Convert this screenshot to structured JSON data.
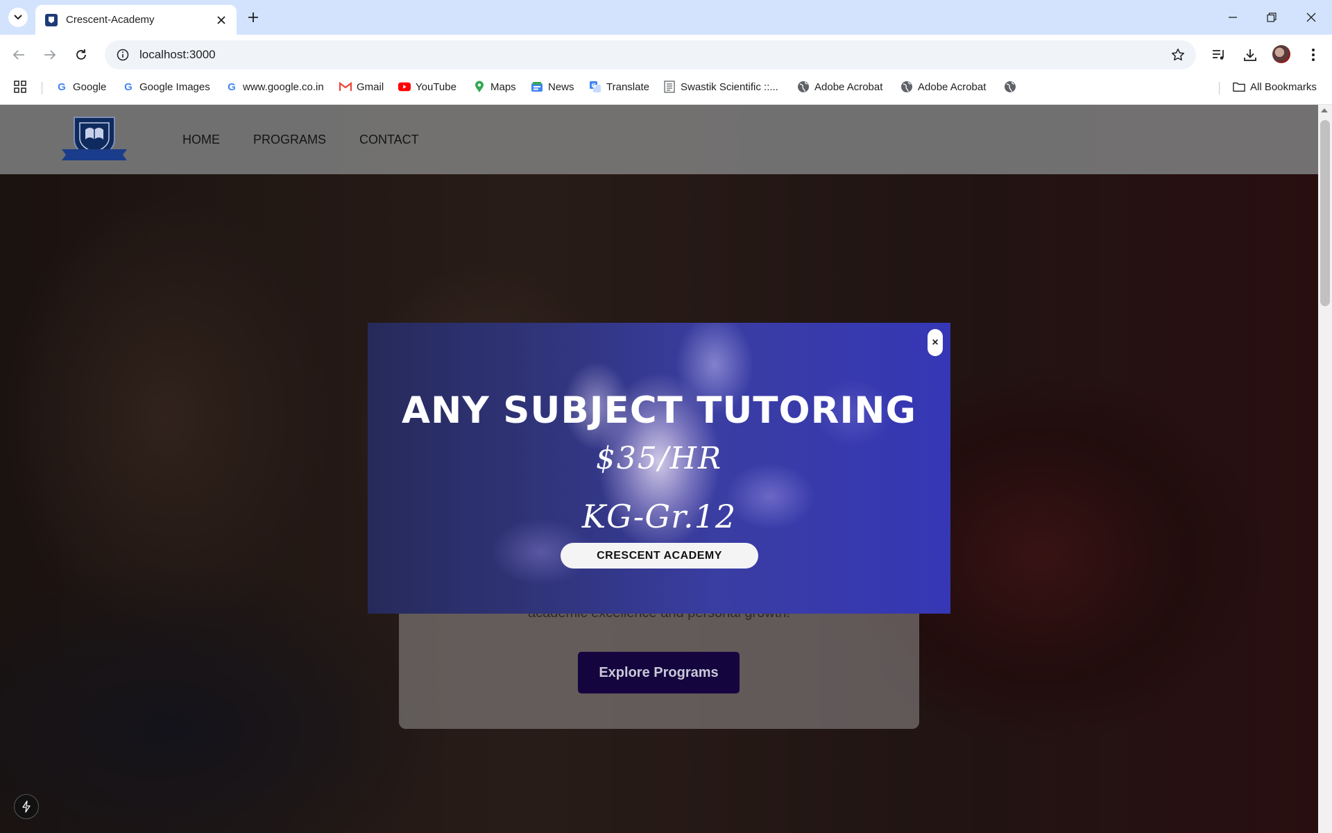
{
  "browser": {
    "tab_title": "Crescent-Academy",
    "url": "localhost:3000"
  },
  "bookmarks": [
    {
      "label": "Google",
      "icon": "google-icon"
    },
    {
      "label": "Google Images",
      "icon": "google-icon"
    },
    {
      "label": "www.google.co.in",
      "icon": "google-icon"
    },
    {
      "label": "Gmail",
      "icon": "gmail-icon"
    },
    {
      "label": "YouTube",
      "icon": "youtube-icon"
    },
    {
      "label": "Maps",
      "icon": "maps-icon"
    },
    {
      "label": "News",
      "icon": "news-icon"
    },
    {
      "label": "Translate",
      "icon": "translate-icon"
    },
    {
      "label": "Swastik Scientific ::...",
      "icon": "document-icon"
    },
    {
      "label": "Adobe Acrobat",
      "icon": "globe-icon"
    },
    {
      "label": "Adobe Acrobat",
      "icon": "globe-icon"
    }
  ],
  "all_bookmarks_label": "All Bookmarks",
  "site": {
    "logo_text": "CRESCENT ACADEMY",
    "nav": [
      "HOME",
      "PROGRAMS",
      "CONTACT"
    ],
    "hero_text": "academic excellence and personal growth!",
    "cta_label": "Explore Programs"
  },
  "modal": {
    "close_label": "×",
    "title": "ANY SUBJECT TUTORING",
    "price": "$35/HR",
    "grades": "KG-Gr.12",
    "badge": "CRESCENT ACADEMY"
  },
  "colors": {
    "tabstrip": "#d3e3fd",
    "cta_bg": "#15053f",
    "modal_blue": "#3537b6"
  }
}
